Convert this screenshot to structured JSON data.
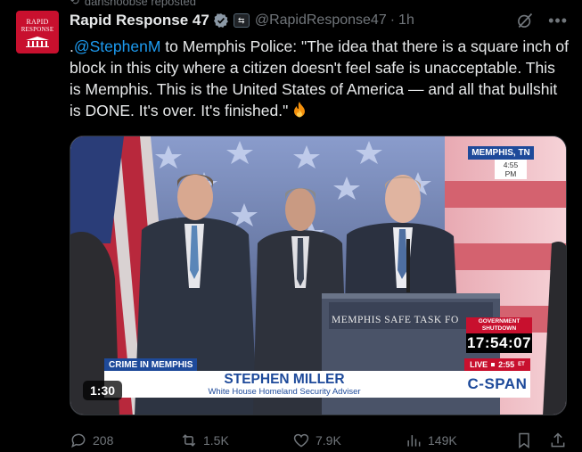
{
  "repost_bar": {
    "text": "danshoobse reposted"
  },
  "author": {
    "avatar_line1": "RAPID",
    "avatar_line2": "RESPONSE",
    "name": "Rapid Response 47",
    "handle": "@RapidResponse47",
    "separator": "·",
    "time": "1h"
  },
  "tweet": {
    "prefix": ".",
    "mention": "@StephenM",
    "body": " to Memphis Police: \"The idea that there is a square inch of block in this city where a citizen doesn't feel safe is unacceptable. This is Memphis. This is the United States of America — and all that bullshit is DONE. It's over. It's finished.\""
  },
  "video": {
    "location": "MEMPHIS, TN",
    "local_time": "4:55 PM",
    "podium_text": "MEMPHIS SAFE TASK FO",
    "gov_label_1": "GOVERNMENT",
    "gov_label_2": "SHUTDOWN",
    "countdown": "17:54:07",
    "segment_tag": "CRIME IN MEMPHIS",
    "speaker_name": "STEPHEN MILLER",
    "speaker_title": "White House Homeland Security Adviser",
    "live_label": "LIVE",
    "live_time": "2:55",
    "live_tz": "ET",
    "network": "C-SPAN",
    "duration": "1:30"
  },
  "actions": {
    "replies": "208",
    "reposts": "1.5K",
    "likes": "7.9K",
    "views": "149K"
  },
  "colors": {
    "mention": "#1d9bf0",
    "muted": "#71767b",
    "cspan_blue": "#1e4a9a",
    "cspan_red": "#c8102e"
  }
}
